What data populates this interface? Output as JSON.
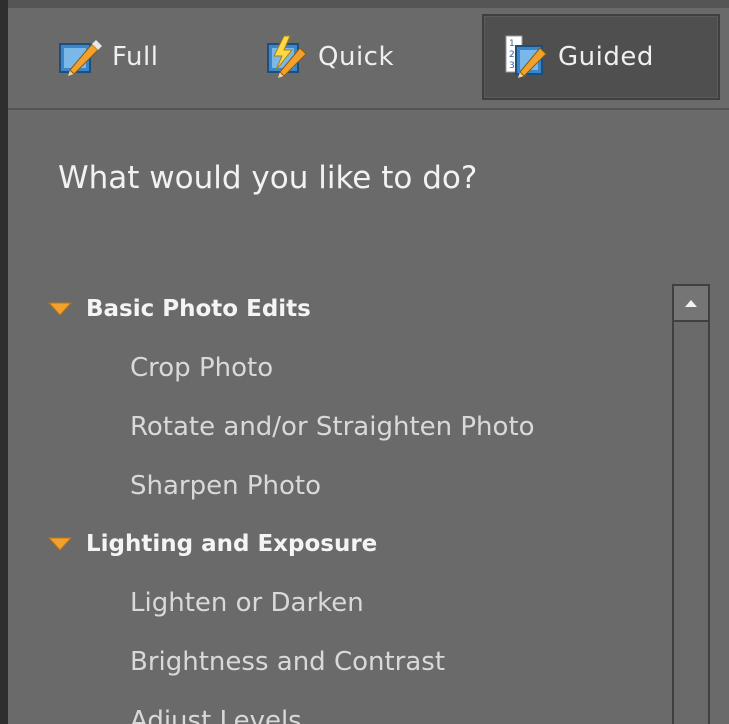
{
  "tabs": [
    {
      "label": "Full",
      "icon": "pencil-on-canvas-icon"
    },
    {
      "label": "Quick",
      "icon": "lightning-pencil-icon"
    },
    {
      "label": "Guided",
      "icon": "numbered-list-pencil-icon",
      "active": true
    }
  ],
  "heading": "What would you like to do?",
  "categories": [
    {
      "label": "Basic Photo Edits",
      "expanded": true,
      "items": [
        "Crop Photo",
        "Rotate and/or Straighten Photo",
        "Sharpen Photo"
      ]
    },
    {
      "label": "Lighting and Exposure",
      "expanded": true,
      "items": [
        "Lighten or Darken",
        "Brightness and Contrast",
        "Adjust Levels"
      ]
    }
  ],
  "colors": {
    "panel_bg": "#6a6a6a",
    "active_tab_bg": "#4f4f4f",
    "category_triangle": "#f2a12c",
    "text_primary": "#f4f4f4",
    "text_secondary": "#d9d9d9"
  }
}
